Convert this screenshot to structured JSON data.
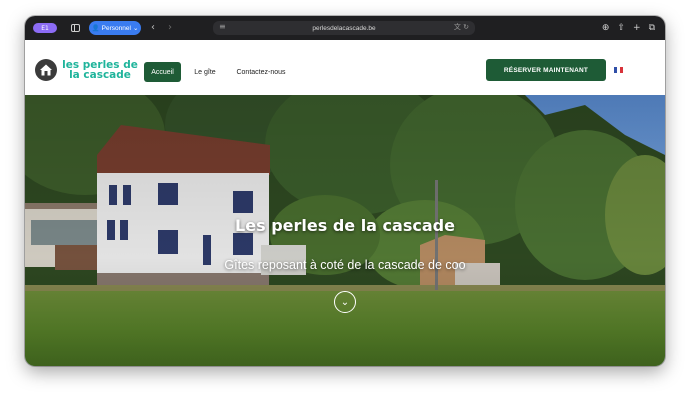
{
  "browser": {
    "tab_badge": "E1",
    "profile_label": "Personnel",
    "address": "perlesdelacascade.be",
    "icons": [
      "sidebar-icon",
      "back-arrow-icon",
      "forward-arrow-icon",
      "site-settings-icon",
      "translate-icon",
      "reload-icon",
      "download-icon",
      "share-icon",
      "new-tab-icon",
      "tabs-overview-icon"
    ]
  },
  "site": {
    "logo_line1": "les perles de",
    "logo_line2": "la cascade",
    "nav": [
      {
        "label": "Accueil",
        "active": true
      },
      {
        "label": "Le gîte",
        "active": false
      },
      {
        "label": "Contactez-nous",
        "active": false
      }
    ],
    "cta_label": "RÉSERVER MAINTENANT",
    "language_flag": "FR"
  },
  "hero": {
    "title": "Les perles de la cascade",
    "subtitle": "Gîtes reposant à coté de la cascade de coo"
  },
  "colors": {
    "brand_green": "#1e5b36",
    "logo_teal": "#1fb49b",
    "browser_chrome": "#1f1f21",
    "profile_blue": "#3a7cf0"
  }
}
